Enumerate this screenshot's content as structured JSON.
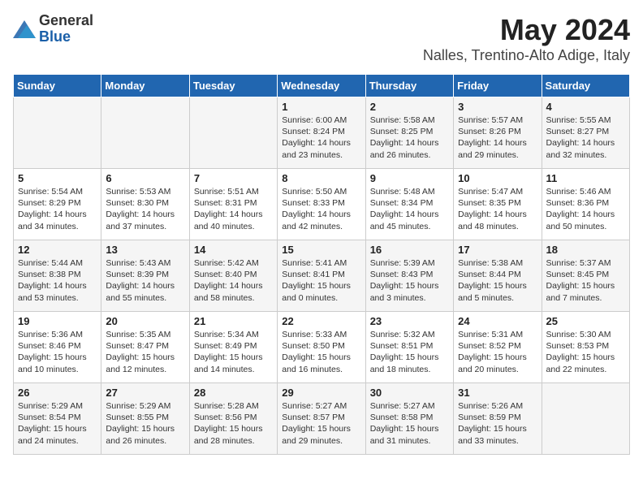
{
  "header": {
    "logo_general": "General",
    "logo_blue": "Blue",
    "title": "May 2024",
    "subtitle": "Nalles, Trentino-Alto Adige, Italy"
  },
  "weekdays": [
    "Sunday",
    "Monday",
    "Tuesday",
    "Wednesday",
    "Thursday",
    "Friday",
    "Saturday"
  ],
  "weeks": [
    [
      {
        "day": "",
        "sunrise": "",
        "sunset": "",
        "daylight": ""
      },
      {
        "day": "",
        "sunrise": "",
        "sunset": "",
        "daylight": ""
      },
      {
        "day": "",
        "sunrise": "",
        "sunset": "",
        "daylight": ""
      },
      {
        "day": "1",
        "sunrise": "Sunrise: 6:00 AM",
        "sunset": "Sunset: 8:24 PM",
        "daylight": "Daylight: 14 hours and 23 minutes."
      },
      {
        "day": "2",
        "sunrise": "Sunrise: 5:58 AM",
        "sunset": "Sunset: 8:25 PM",
        "daylight": "Daylight: 14 hours and 26 minutes."
      },
      {
        "day": "3",
        "sunrise": "Sunrise: 5:57 AM",
        "sunset": "Sunset: 8:26 PM",
        "daylight": "Daylight: 14 hours and 29 minutes."
      },
      {
        "day": "4",
        "sunrise": "Sunrise: 5:55 AM",
        "sunset": "Sunset: 8:27 PM",
        "daylight": "Daylight: 14 hours and 32 minutes."
      }
    ],
    [
      {
        "day": "5",
        "sunrise": "Sunrise: 5:54 AM",
        "sunset": "Sunset: 8:29 PM",
        "daylight": "Daylight: 14 hours and 34 minutes."
      },
      {
        "day": "6",
        "sunrise": "Sunrise: 5:53 AM",
        "sunset": "Sunset: 8:30 PM",
        "daylight": "Daylight: 14 hours and 37 minutes."
      },
      {
        "day": "7",
        "sunrise": "Sunrise: 5:51 AM",
        "sunset": "Sunset: 8:31 PM",
        "daylight": "Daylight: 14 hours and 40 minutes."
      },
      {
        "day": "8",
        "sunrise": "Sunrise: 5:50 AM",
        "sunset": "Sunset: 8:33 PM",
        "daylight": "Daylight: 14 hours and 42 minutes."
      },
      {
        "day": "9",
        "sunrise": "Sunrise: 5:48 AM",
        "sunset": "Sunset: 8:34 PM",
        "daylight": "Daylight: 14 hours and 45 minutes."
      },
      {
        "day": "10",
        "sunrise": "Sunrise: 5:47 AM",
        "sunset": "Sunset: 8:35 PM",
        "daylight": "Daylight: 14 hours and 48 minutes."
      },
      {
        "day": "11",
        "sunrise": "Sunrise: 5:46 AM",
        "sunset": "Sunset: 8:36 PM",
        "daylight": "Daylight: 14 hours and 50 minutes."
      }
    ],
    [
      {
        "day": "12",
        "sunrise": "Sunrise: 5:44 AM",
        "sunset": "Sunset: 8:38 PM",
        "daylight": "Daylight: 14 hours and 53 minutes."
      },
      {
        "day": "13",
        "sunrise": "Sunrise: 5:43 AM",
        "sunset": "Sunset: 8:39 PM",
        "daylight": "Daylight: 14 hours and 55 minutes."
      },
      {
        "day": "14",
        "sunrise": "Sunrise: 5:42 AM",
        "sunset": "Sunset: 8:40 PM",
        "daylight": "Daylight: 14 hours and 58 minutes."
      },
      {
        "day": "15",
        "sunrise": "Sunrise: 5:41 AM",
        "sunset": "Sunset: 8:41 PM",
        "daylight": "Daylight: 15 hours and 0 minutes."
      },
      {
        "day": "16",
        "sunrise": "Sunrise: 5:39 AM",
        "sunset": "Sunset: 8:43 PM",
        "daylight": "Daylight: 15 hours and 3 minutes."
      },
      {
        "day": "17",
        "sunrise": "Sunrise: 5:38 AM",
        "sunset": "Sunset: 8:44 PM",
        "daylight": "Daylight: 15 hours and 5 minutes."
      },
      {
        "day": "18",
        "sunrise": "Sunrise: 5:37 AM",
        "sunset": "Sunset: 8:45 PM",
        "daylight": "Daylight: 15 hours and 7 minutes."
      }
    ],
    [
      {
        "day": "19",
        "sunrise": "Sunrise: 5:36 AM",
        "sunset": "Sunset: 8:46 PM",
        "daylight": "Daylight: 15 hours and 10 minutes."
      },
      {
        "day": "20",
        "sunrise": "Sunrise: 5:35 AM",
        "sunset": "Sunset: 8:47 PM",
        "daylight": "Daylight: 15 hours and 12 minutes."
      },
      {
        "day": "21",
        "sunrise": "Sunrise: 5:34 AM",
        "sunset": "Sunset: 8:49 PM",
        "daylight": "Daylight: 15 hours and 14 minutes."
      },
      {
        "day": "22",
        "sunrise": "Sunrise: 5:33 AM",
        "sunset": "Sunset: 8:50 PM",
        "daylight": "Daylight: 15 hours and 16 minutes."
      },
      {
        "day": "23",
        "sunrise": "Sunrise: 5:32 AM",
        "sunset": "Sunset: 8:51 PM",
        "daylight": "Daylight: 15 hours and 18 minutes."
      },
      {
        "day": "24",
        "sunrise": "Sunrise: 5:31 AM",
        "sunset": "Sunset: 8:52 PM",
        "daylight": "Daylight: 15 hours and 20 minutes."
      },
      {
        "day": "25",
        "sunrise": "Sunrise: 5:30 AM",
        "sunset": "Sunset: 8:53 PM",
        "daylight": "Daylight: 15 hours and 22 minutes."
      }
    ],
    [
      {
        "day": "26",
        "sunrise": "Sunrise: 5:29 AM",
        "sunset": "Sunset: 8:54 PM",
        "daylight": "Daylight: 15 hours and 24 minutes."
      },
      {
        "day": "27",
        "sunrise": "Sunrise: 5:29 AM",
        "sunset": "Sunset: 8:55 PM",
        "daylight": "Daylight: 15 hours and 26 minutes."
      },
      {
        "day": "28",
        "sunrise": "Sunrise: 5:28 AM",
        "sunset": "Sunset: 8:56 PM",
        "daylight": "Daylight: 15 hours and 28 minutes."
      },
      {
        "day": "29",
        "sunrise": "Sunrise: 5:27 AM",
        "sunset": "Sunset: 8:57 PM",
        "daylight": "Daylight: 15 hours and 29 minutes."
      },
      {
        "day": "30",
        "sunrise": "Sunrise: 5:27 AM",
        "sunset": "Sunset: 8:58 PM",
        "daylight": "Daylight: 15 hours and 31 minutes."
      },
      {
        "day": "31",
        "sunrise": "Sunrise: 5:26 AM",
        "sunset": "Sunset: 8:59 PM",
        "daylight": "Daylight: 15 hours and 33 minutes."
      },
      {
        "day": "",
        "sunrise": "",
        "sunset": "",
        "daylight": ""
      }
    ]
  ]
}
